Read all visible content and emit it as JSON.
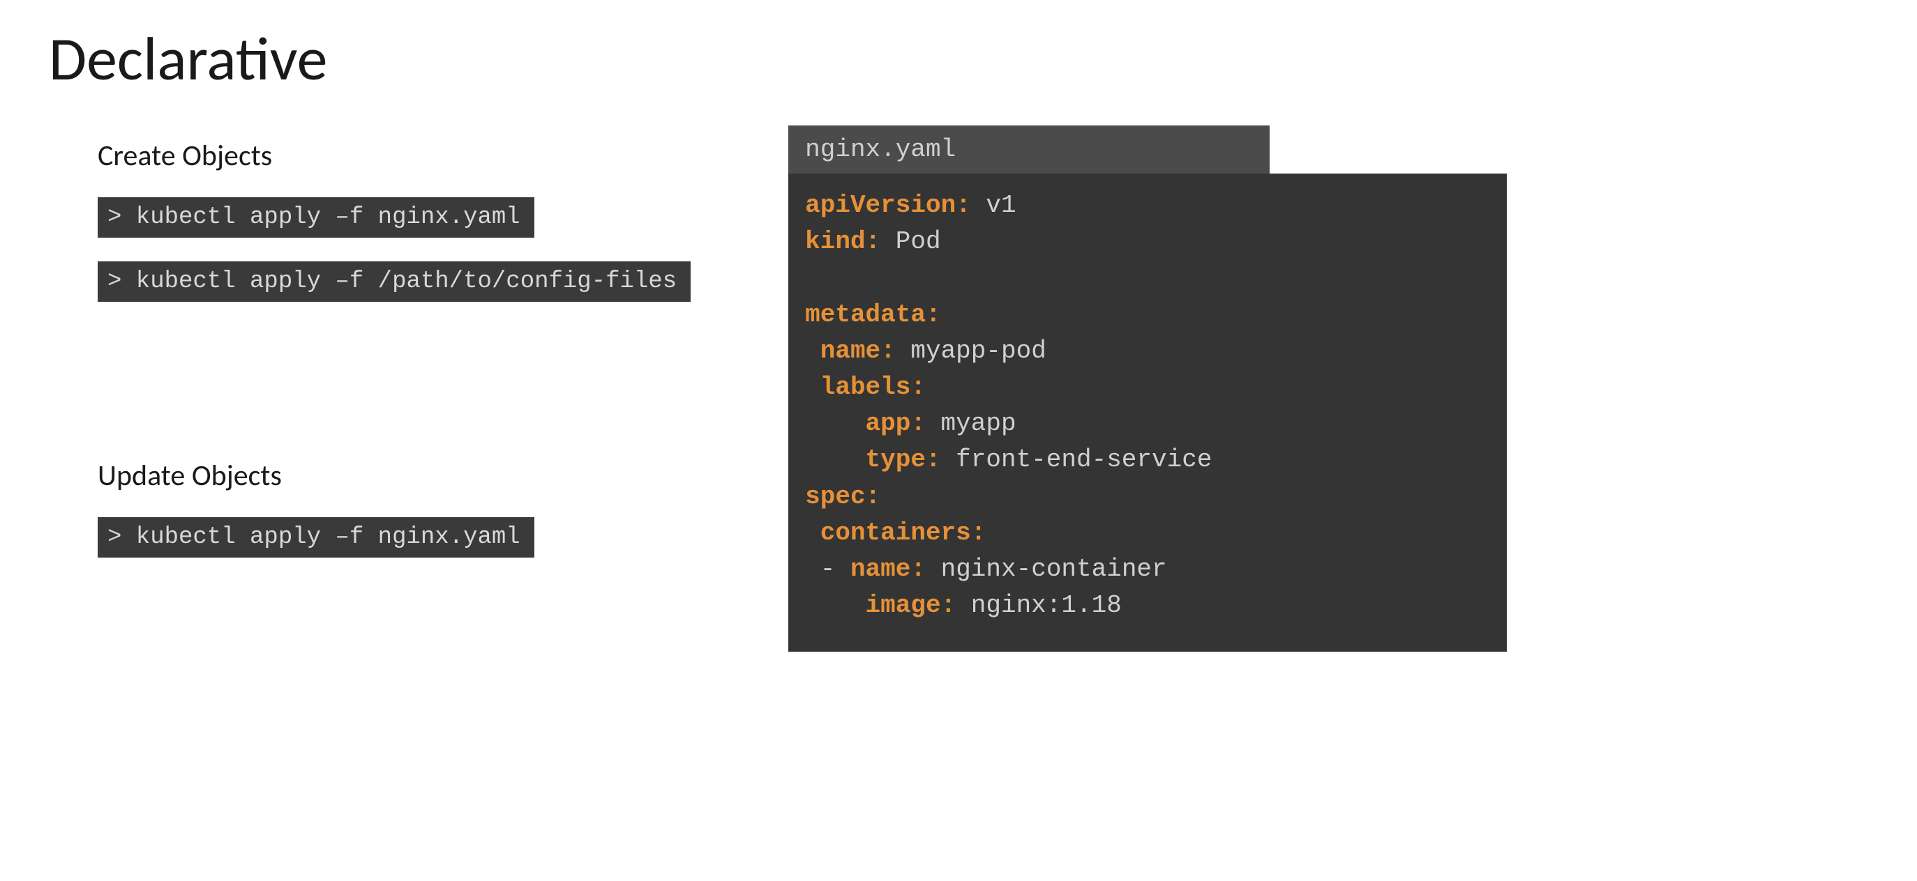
{
  "title": "Declarative",
  "sections": {
    "create": {
      "heading": "Create Objects",
      "cmd1": "> kubectl apply –f nginx.yaml",
      "cmd2": "> kubectl apply –f /path/to/config-files"
    },
    "update": {
      "heading": "Update Objects",
      "cmd1": "> kubectl apply –f nginx.yaml"
    }
  },
  "yaml": {
    "filename": "nginx.yaml",
    "keys": {
      "apiVersion": "apiVersion:",
      "kind": "kind:",
      "metadata": "metadata:",
      "name": "name:",
      "labels": "labels:",
      "app": "app:",
      "type": "type:",
      "spec": "spec:",
      "containers": "containers:",
      "cname": "name:",
      "image": "image:"
    },
    "values": {
      "apiVersion": " v1",
      "kind": " Pod",
      "name": " myapp-pod",
      "app": " myapp",
      "type": " front-end-service",
      "cname": " nginx-container",
      "image": " nginx:1.18",
      "dash": "- "
    }
  }
}
